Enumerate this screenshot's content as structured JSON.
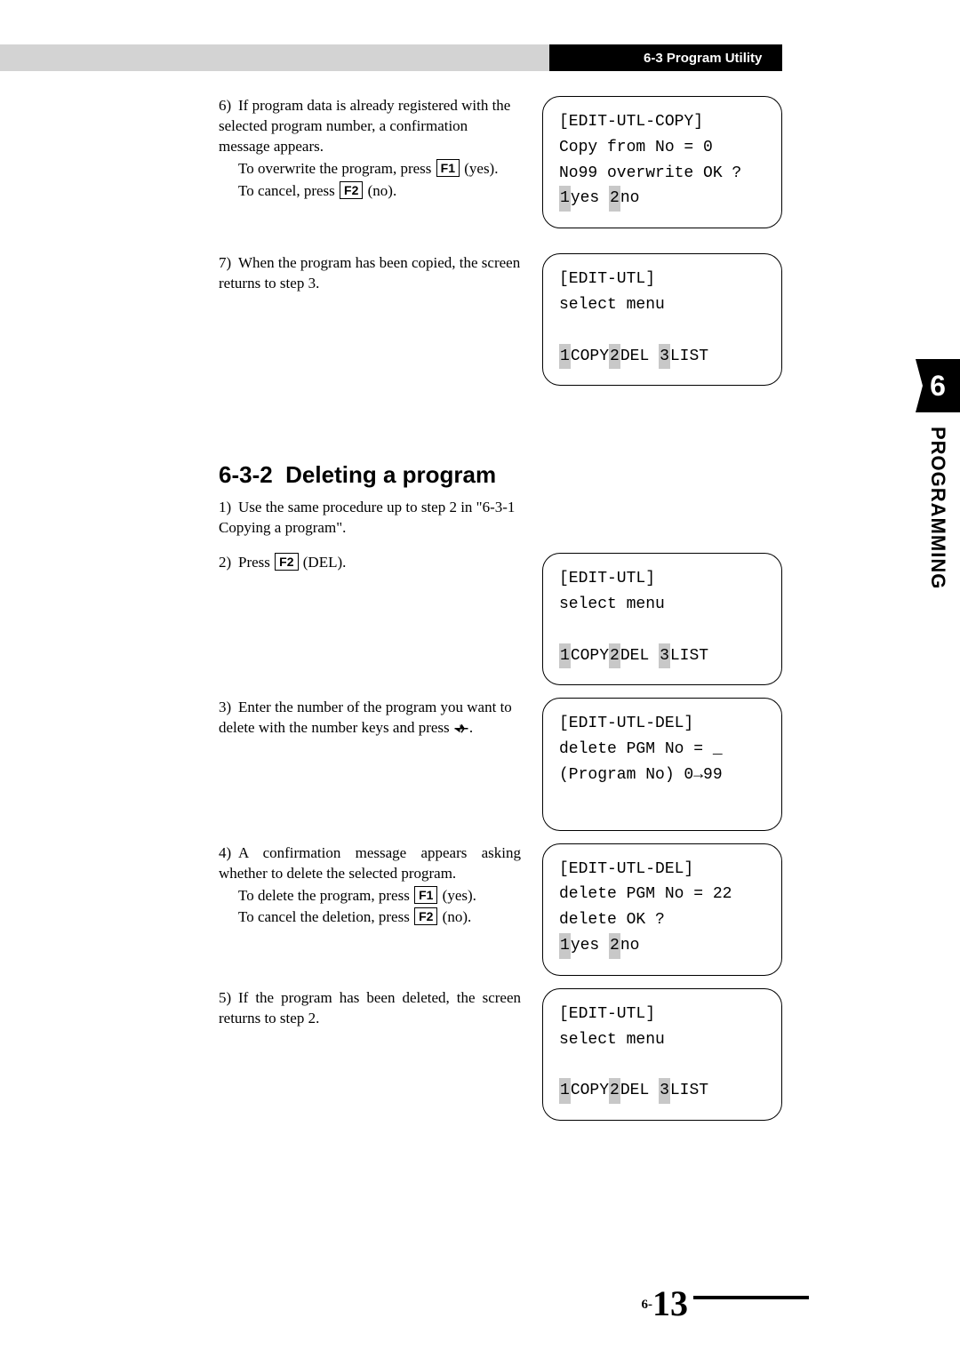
{
  "header": {
    "section_label": "6-3 Program Utility"
  },
  "side": {
    "chapter_num": "6",
    "chapter_label": "PROGRAMMING"
  },
  "steps_a": {
    "s6": {
      "num": "6)",
      "text": "If program data is already registered with the selected program number, a confirmation message appears.",
      "line2a": "To overwrite the program, press ",
      "key1": "F1",
      "line2b": " (yes).",
      "line3a": "To cancel, press ",
      "key2": "F2",
      "line3b": " (no)."
    },
    "s7": {
      "num": "7)",
      "text": "When the program has been copied, the screen returns to step 3."
    }
  },
  "screen1": {
    "l1": "[EDIT-UTL-COPY]",
    "l2": "Copy from No = 0",
    "l3": "No99 overwrite OK ?",
    "h1": "1",
    "t1": "yes ",
    "h2": "2",
    "t2": "no"
  },
  "screen_utl": {
    "l1": "[EDIT-UTL]",
    "l2": "select menu",
    "h1": "1",
    "t1": "COPY",
    "h2": "2",
    "t2": "DEL ",
    "h3": "3",
    "t3": "LIST"
  },
  "section_b": {
    "heading_pre": "6-3-2",
    "heading": "Deleting a program",
    "s1": {
      "num": "1)",
      "text": "Use the same procedure up to step 2 in \"6-3-1 Copying a program\"."
    },
    "s2": {
      "num": "2)",
      "pre": "Press ",
      "key": "F2",
      "post": " (DEL)."
    },
    "s3": {
      "num": "3)",
      "text_a": "Enter the number of the program you want to delete with the number keys and press ",
      "text_b": "."
    },
    "s4": {
      "num": "4)",
      "text": "A confirmation message appears asking whether to delete the selected program.",
      "line2a": "To delete the program, press ",
      "key1": "F1",
      "line2b": " (yes).",
      "line3a": "To cancel the deletion, press ",
      "key2": "F2",
      "line3b": " (no)."
    },
    "s5": {
      "num": "5)",
      "text": "If the program has been deleted, the screen returns to step 2."
    }
  },
  "screen_del1": {
    "l1": "[EDIT-UTL-DEL]",
    "l2": "delete PGM No = _",
    "l3a": "(Program No) 0",
    "l3b": "99"
  },
  "screen_del2": {
    "l1": "[EDIT-UTL-DEL]",
    "l2": "delete PGM No = 22",
    "l3": "delete OK ?",
    "h1": "1",
    "t1": "yes ",
    "h2": "2",
    "t2": "no"
  },
  "page_num": {
    "prefix": "6-",
    "num": "13"
  }
}
